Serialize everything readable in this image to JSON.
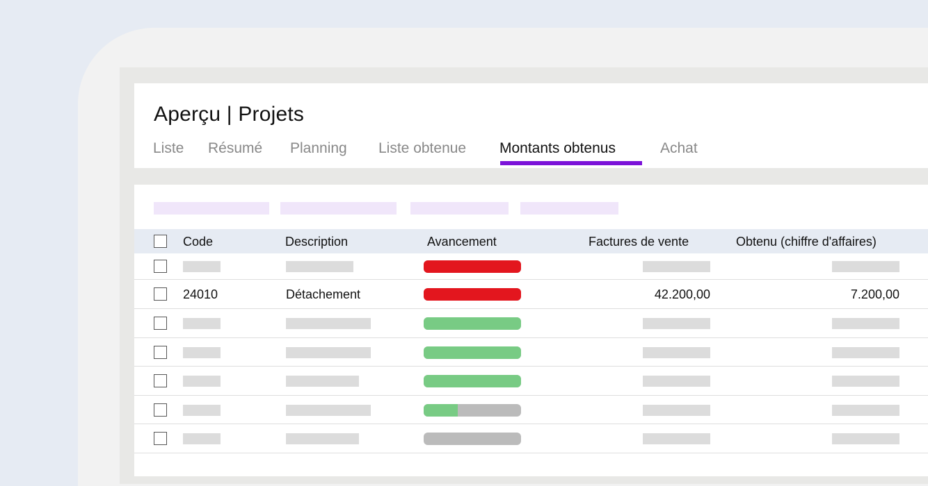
{
  "page": {
    "title": "Aperçu | Projets",
    "tabs": [
      {
        "label": "Liste"
      },
      {
        "label": "Résumé"
      },
      {
        "label": "Planning"
      },
      {
        "label": "Liste obtenue"
      },
      {
        "label": "Montants obtenus",
        "active": true
      },
      {
        "label": "Achat"
      }
    ]
  },
  "colors": {
    "accent": "#7b12d8",
    "progress_red": "#e3161e",
    "progress_green": "#78cb84",
    "progress_track": "#bbbbbb"
  },
  "table": {
    "headers": {
      "code": "Code",
      "description": "Description",
      "progress": "Avancement",
      "invoices": "Factures de vente",
      "obtained": "Obtenu (chiffre d'affaires)"
    },
    "rows": [
      {
        "code": "",
        "description": "",
        "progress": 1.0,
        "progress_color": "red",
        "invoices": "",
        "obtained": ""
      },
      {
        "code": "24010",
        "description": "Détachement",
        "progress": 1.0,
        "progress_color": "red",
        "invoices": "42.200,00",
        "obtained": "7.200,00"
      },
      {
        "code": "",
        "description": "",
        "progress": 1.0,
        "progress_color": "green",
        "invoices": "",
        "obtained": ""
      },
      {
        "code": "",
        "description": "",
        "progress": 1.0,
        "progress_color": "green",
        "invoices": "",
        "obtained": ""
      },
      {
        "code": "",
        "description": "",
        "progress": 1.0,
        "progress_color": "green",
        "invoices": "",
        "obtained": ""
      },
      {
        "code": "",
        "description": "",
        "progress": 0.35,
        "progress_color": "green",
        "invoices": "",
        "obtained": ""
      },
      {
        "code": "",
        "description": "",
        "progress": 0.0,
        "progress_color": "green",
        "invoices": "",
        "obtained": ""
      }
    ]
  }
}
